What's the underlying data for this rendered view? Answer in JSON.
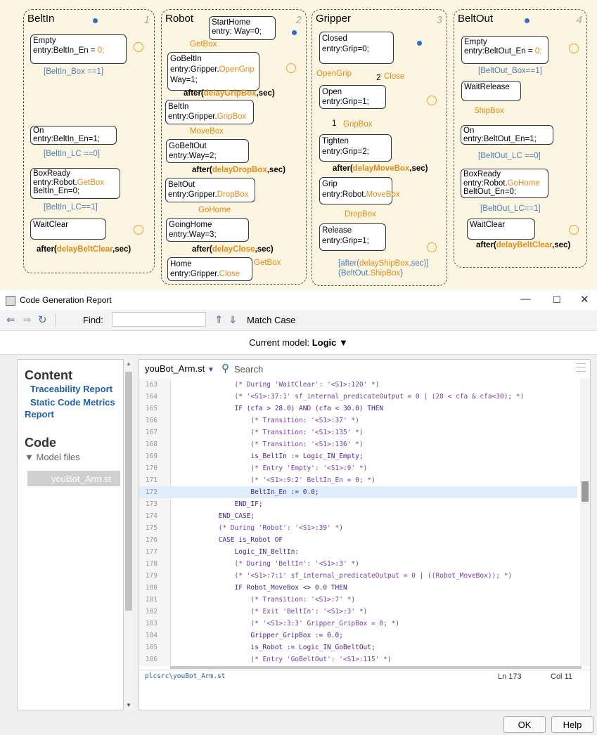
{
  "chart": {
    "beltin": {
      "title": "BeltIn",
      "num": "1",
      "empty": [
        "Empty",
        "entry:BeltIn_En = ",
        "0;"
      ],
      "t1": "[BeltIn_Box ==1]",
      "on": [
        "On",
        "entry:BeltIn_En=1;"
      ],
      "t2": "[BeltIn_LC ==0]",
      "boxready": [
        "BoxReady",
        "entry:Robot.",
        "GetBox",
        "BeltIn_En=0;"
      ],
      "t3": "[BeltIn_LC==1]",
      "waitclear": "WaitClear",
      "after": "after(",
      "after_arg": "delayBeltClear",
      "after_end": ",sec)"
    },
    "robot": {
      "title": "Robot",
      "num": "2",
      "starthome": [
        "StartHome",
        "entry: Way=0;"
      ],
      "getbox_label": "GetBox",
      "gobeltin": [
        "GoBeltIn",
        "entry:Gripper.",
        "OpenGrip",
        "Way=1;"
      ],
      "after1": "after(",
      "after1_arg": "delayGripBox",
      "after1_end": ",sec)",
      "beltin": [
        "BeltIn",
        "entry:Gripper.",
        "GripBox"
      ],
      "movebox": "MoveBox",
      "gobeltout": [
        "GoBeltOut",
        "entry:Way=2;"
      ],
      "after2": "after(",
      "after2_arg": "delayDropBox",
      "after2_end": ",sec)",
      "beltout": [
        "BeltOut",
        "entry:Gripper.",
        "DropBox"
      ],
      "gohome": "GoHome",
      "goinghome": [
        "GoingHome",
        "entry:Way=3;"
      ],
      "after3": "after(",
      "after3_arg": "delayClose",
      "after3_end": ",sec)",
      "home": [
        "Home",
        "entry:Gripper.",
        "Close"
      ],
      "getbox2": "GetBox"
    },
    "gripper": {
      "title": "Gripper",
      "num": "3",
      "closed": [
        "Closed",
        "entry:Grip=0;"
      ],
      "opengrip": "OpenGrip",
      "close": "Close",
      "n2": "2",
      "n1": "1",
      "open": [
        "Open",
        "entry:Grip=1;"
      ],
      "gripbox": "GripBox",
      "tighten": [
        "Tighten",
        "entry:Grip=2;"
      ],
      "after": "after(",
      "after_arg": "delayMoveBox",
      "after_end": ",sec)",
      "grip": [
        "Grip",
        "entry:Robot.",
        "MoveBox"
      ],
      "dropbox": "DropBox",
      "release": [
        "Release",
        "entry:Grip=1;"
      ],
      "t_after": "[after(",
      "t_after_arg": "delayShipBox",
      "t_after_end": ",sec)]",
      "t_action": "{BeltOut.",
      "t_action_arg": "ShipBox",
      "t_action_end": "}"
    },
    "beltout": {
      "title": "BeltOut",
      "num": "4",
      "empty": [
        "Empty",
        "entry:BeltOut_En = ",
        "0;"
      ],
      "t1": "[BeltOut_Box==1]",
      "waitrelease": "WaitRelease",
      "shipbox": "ShipBox",
      "on": [
        "On",
        "entry:BeltOut_En=1;"
      ],
      "t2": "[BeltOut_LC ==0]",
      "boxready": [
        "BoxReady",
        "entry:Robot.",
        "GoHome",
        "BeltOut_En=0;"
      ],
      "t3": "[BeltOut_LC==1]",
      "waitclear": "WaitClear",
      "after": "after(",
      "after_arg": "delayBeltClear",
      "after_end": ",sec)"
    }
  },
  "window": {
    "title": "Code Generation Report",
    "find_label": "Find:",
    "find_value": "",
    "match_case": "Match Case",
    "current_model_prefix": "Current model:",
    "current_model": "Logic"
  },
  "sidebar": {
    "content_heading": "Content",
    "traceability": "Traceability Report",
    "metrics": "Static Code Metrics Report",
    "code_heading": "Code",
    "model_files": "Model files",
    "file": "youBot_Arm.st"
  },
  "code": {
    "file_selector": "youBot_Arm.st",
    "search_placeholder": "Search",
    "highlighted_line": "172",
    "lines": [
      {
        "n": "163",
        "t": "                (* During 'WaitClear': '<S1>:120' *)"
      },
      {
        "n": "164",
        "t": "                (* '<S1>:37:1' sf_internal_predicateOutput = 0 | (28 < cfa & cfa<30); *)"
      },
      {
        "n": "165",
        "t": "                IF (cfa > 28.0) AND (cfa < 30.0) THEN"
      },
      {
        "n": "166",
        "t": "                    (* Transition: '<S1>:37' *)"
      },
      {
        "n": "167",
        "t": "                    (* Transition: '<S1>:135' *)"
      },
      {
        "n": "168",
        "t": "                    (* Transition: '<S1>:136' *)"
      },
      {
        "n": "169",
        "t": "                    is_BeltIn := Logic_IN_Empty;"
      },
      {
        "n": "170",
        "t": "                    (* Entry 'Empty': '<S1>:9' *)"
      },
      {
        "n": "171",
        "t": "                    (* '<S1>:9:2' BeltIn_En = 0; *)"
      },
      {
        "n": "172",
        "t": "                    BeltIn_En := 0.0;"
      },
      {
        "n": "173",
        "t": "                END_IF;"
      },
      {
        "n": "174",
        "t": "            END_CASE;"
      },
      {
        "n": "175",
        "t": "            (* During 'Robot': '<S1>:39' *)"
      },
      {
        "n": "176",
        "t": "            CASE is_Robot OF"
      },
      {
        "n": "177",
        "t": "                Logic_IN_BeltIn:"
      },
      {
        "n": "178",
        "t": "                (* During 'BeltIn': '<S1>:3' *)"
      },
      {
        "n": "179",
        "t": "                (* '<S1>:7:1' sf_internal_predicateOutput = 0 | ((Robot_MoveBox)); *)"
      },
      {
        "n": "180",
        "t": "                IF Robot_MoveBox <> 0.0 THEN"
      },
      {
        "n": "181",
        "t": "                    (* Transition: '<S1>:7' *)"
      },
      {
        "n": "182",
        "t": "                    (* Exit 'BeltIn': '<S1>:3' *)"
      },
      {
        "n": "183",
        "t": "                    (* '<S1>:3:3' Gripper_GripBox = 0; *)"
      },
      {
        "n": "184",
        "t": "                    Gripper_GripBox := 0.0;"
      },
      {
        "n": "185",
        "t": "                    is_Robot := Logic_IN_GoBeltOut;"
      },
      {
        "n": "186",
        "t": "                    (* Entry 'GoBeltOut': '<S1>:115' *)"
      }
    ],
    "status_path": "plcsrc\\youBot_Arm.st",
    "status_ln": "Ln  173",
    "status_col": "Col  11"
  },
  "buttons": {
    "ok": "OK",
    "help": "Help"
  }
}
